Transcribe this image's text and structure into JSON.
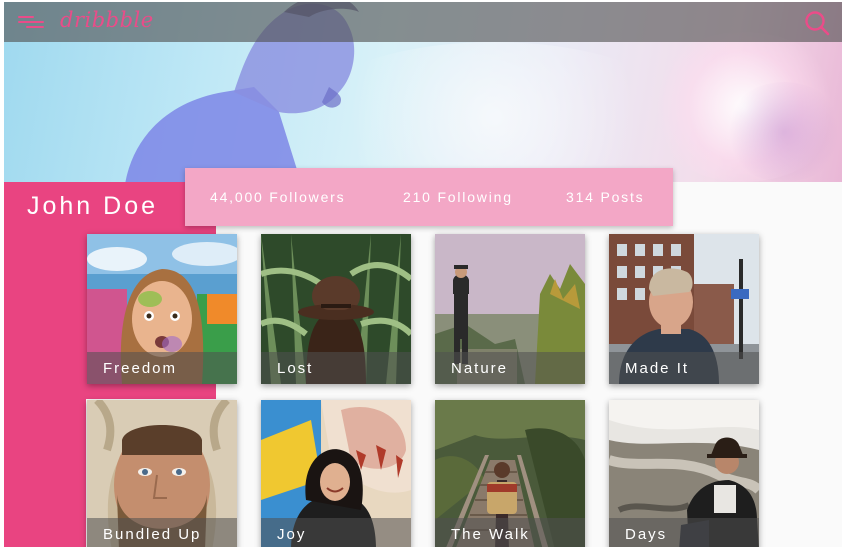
{
  "header": {
    "logo_text": "dribbble",
    "menu_icon": "hamburger-menu-icon",
    "search_icon": "search-icon"
  },
  "profile": {
    "name": "John Doe",
    "stats": {
      "followers": "44,000 Followers",
      "following": "210 Following",
      "posts": "314 Posts"
    }
  },
  "gallery": {
    "items": [
      {
        "label": "Freedom"
      },
      {
        "label": "Lost"
      },
      {
        "label": "Nature"
      },
      {
        "label": "Made It"
      },
      {
        "label": "Bundled Up"
      },
      {
        "label": "Joy"
      },
      {
        "label": "The Walk"
      },
      {
        "label": "Days"
      }
    ]
  },
  "colors": {
    "accent": "#ea4c89",
    "side_panel": "#e94481",
    "stats_bar": "#f3a7c6"
  }
}
